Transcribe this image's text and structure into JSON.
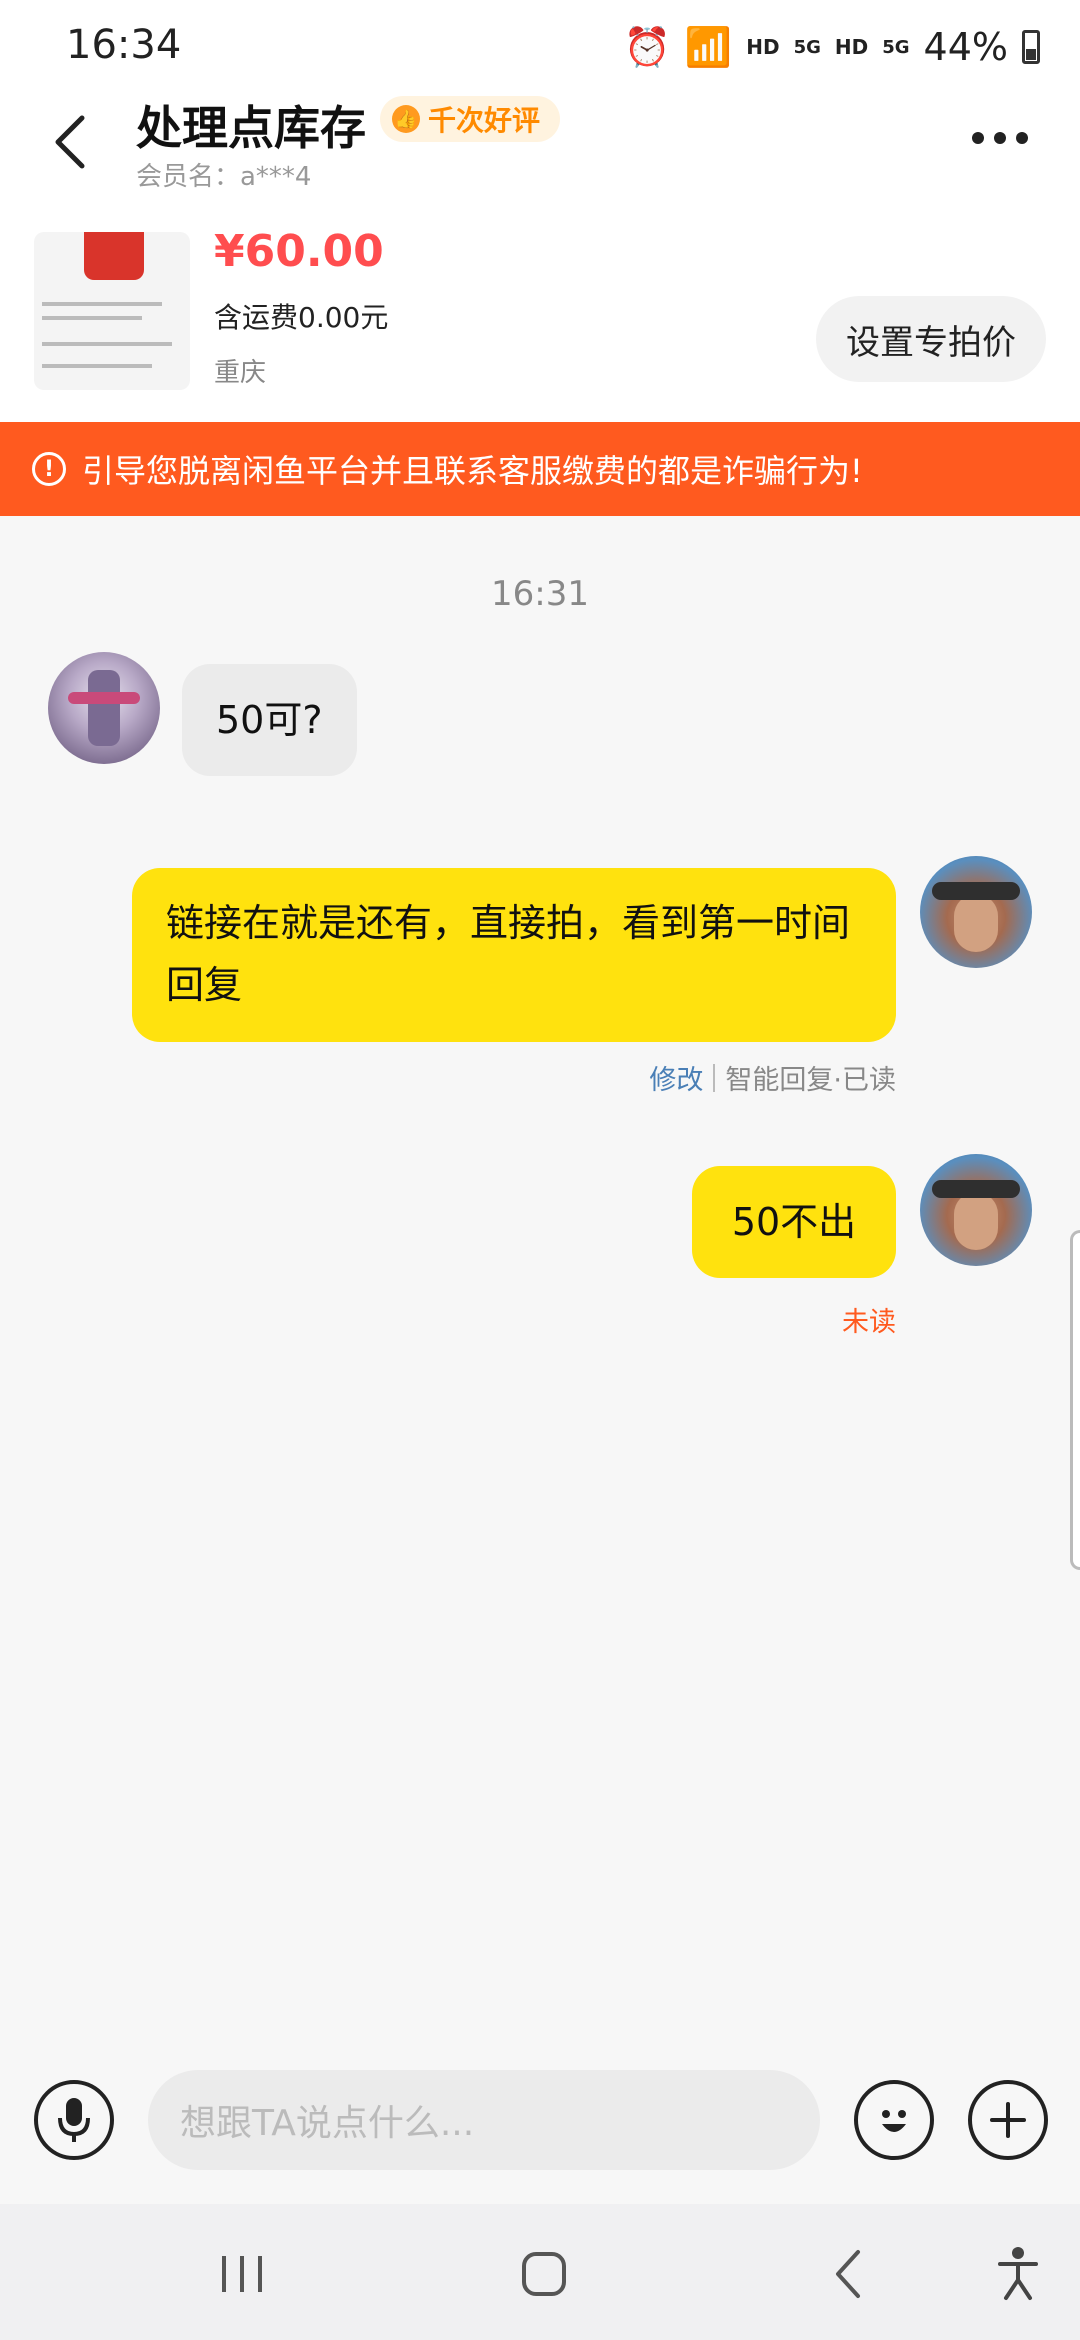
{
  "status_bar": {
    "time": "16:34",
    "network_1": "HD",
    "network_2": "HD",
    "signal_1": "5G",
    "signal_2": "5G",
    "battery": "44%"
  },
  "header": {
    "title": "处理点库存",
    "badge": "千次好评",
    "member": "会员名：a***4"
  },
  "product": {
    "price": "¥60.00",
    "shipping": "含运费0.00元",
    "location": "重庆",
    "special_price_button": "设置专拍价"
  },
  "warning": {
    "text": "引导您脱离闲鱼平台并且联系客服缴费的都是诈骗行为!"
  },
  "chat": {
    "timestamp": "16:31",
    "messages": [
      {
        "text": "50可?"
      },
      {
        "text": "链接在就是还有，直接拍，看到第一时间回复",
        "edit": "修改",
        "status": "智能回复·已读"
      },
      {
        "text": "50不出",
        "status": "未读"
      }
    ]
  },
  "input": {
    "placeholder": "想跟TA说点什么..."
  },
  "colors": {
    "accent_yellow": "#ffe20e",
    "warning_orange": "#ff5a1f",
    "price_red": "#ff4d4f",
    "badge_orange": "#ff8a00"
  },
  "icons": [
    "back-arrow-icon",
    "more-icon",
    "alert-icon",
    "microphone-icon",
    "emoji-icon",
    "plus-icon"
  ]
}
